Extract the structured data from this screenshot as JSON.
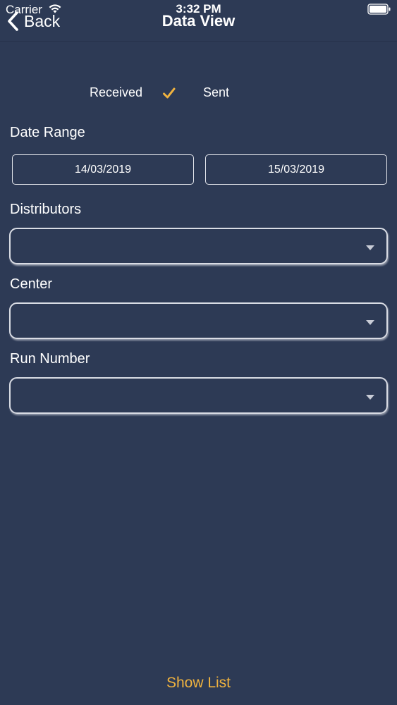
{
  "status_bar": {
    "carrier": "Carrier",
    "time": "3:32 PM"
  },
  "nav": {
    "back_label": "Back",
    "title": "Data View"
  },
  "segment": {
    "received_label": "Received",
    "sent_label": "Sent",
    "selected": "Received"
  },
  "date_range": {
    "label": "Date Range",
    "from": "14/03/2019",
    "to": "15/03/2019"
  },
  "distributors": {
    "label": "Distributors",
    "value": ""
  },
  "center": {
    "label": "Center",
    "value": ""
  },
  "run_number": {
    "label": "Run Number",
    "value": ""
  },
  "footer": {
    "show_list_label": "Show List"
  },
  "colors": {
    "background": "#2d3a55",
    "accent": "#f0b33f",
    "text": "#ffffff",
    "caret": "#c8ccd6"
  },
  "icons": {
    "wifi": "wifi-icon",
    "battery": "battery-icon",
    "back": "chevron-left-icon",
    "check": "checkmark-icon",
    "caret": "caret-down-icon"
  }
}
